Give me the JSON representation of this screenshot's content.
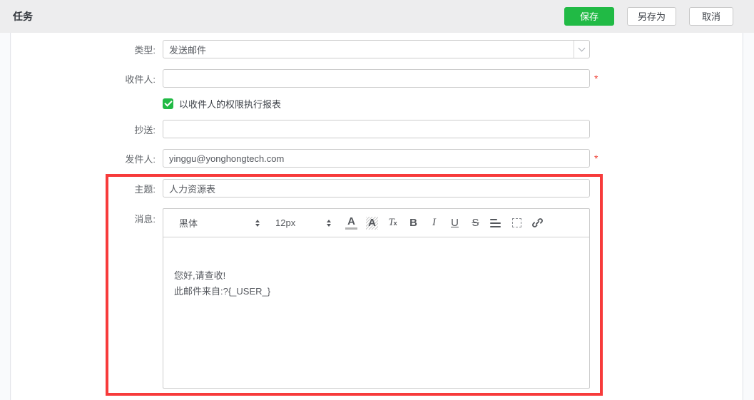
{
  "header": {
    "title": "任务",
    "save_label": "保存",
    "save_as_label": "另存为",
    "cancel_label": "取消"
  },
  "form": {
    "type": {
      "label": "类型:",
      "value": "发送邮件"
    },
    "recipient": {
      "label": "收件人:",
      "value": "",
      "required_mark": "*"
    },
    "permission_checkbox": {
      "label": "以收件人的权限执行报表",
      "checked": true
    },
    "cc": {
      "label": "抄送:",
      "value": ""
    },
    "sender": {
      "label": "发件人:",
      "value": "yinggu@yonghongtech.com",
      "required_mark": "*"
    },
    "subject": {
      "label": "主题:",
      "value": "人力资源表"
    },
    "message": {
      "label": "消息:"
    }
  },
  "editor": {
    "font_name": "黑体",
    "font_size": "12px",
    "glyphs": {
      "font_color": "A",
      "fill_color": "A",
      "clear_t": "T",
      "clear_x": "x",
      "bold": "B",
      "italic": "I",
      "underline": "U",
      "strikethrough": "S"
    },
    "icons": {
      "font_spinner": "up-down-arrows",
      "size_spinner": "up-down-arrows",
      "font_color": "letter-A-with-underline",
      "fill_color": "letter-A-hatched-background",
      "clear_format": "Tx",
      "bold": "B",
      "italic": "I",
      "underline": "U",
      "strikethrough": "S",
      "align": "three-horizontal-lines",
      "placeholder_box": "dashed-box",
      "link": "chain-link"
    },
    "body_lines": [
      "您好,请查收!",
      "此邮件来自:?{_USER_}"
    ]
  },
  "annotation": {
    "highlight_rect_color": "#f73b3b"
  },
  "colors": {
    "accent_green": "#21ba45",
    "required_red": "#ef4136",
    "header_bg": "#ededee"
  }
}
